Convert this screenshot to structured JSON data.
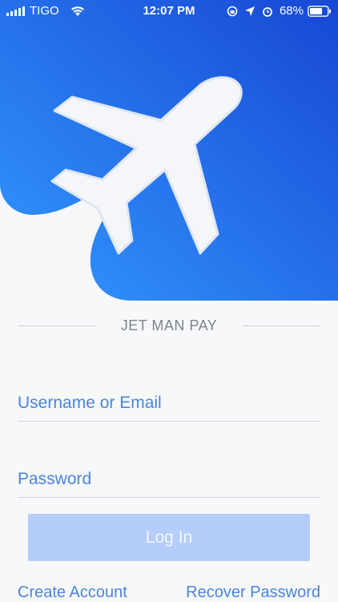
{
  "status_bar": {
    "carrier": "TIGO",
    "time": "12:07 PM",
    "battery_percent": "68%",
    "icons": [
      "signal-icon",
      "wifi-icon",
      "screen-lock-icon",
      "location-icon",
      "alarm-icon",
      "battery-icon"
    ]
  },
  "hero": {
    "icon": "airplane-icon",
    "gradient_colors": [
      "#2f8ffb",
      "#1a4fd8"
    ],
    "plane_color": "#f4f6f9"
  },
  "brand": {
    "title": "JET MAN PAY"
  },
  "form": {
    "username_placeholder": "Username or Email",
    "password_placeholder": "Password",
    "login_label": "Log In"
  },
  "links": {
    "create_account": "Create Account",
    "recover_password": "Recover Password"
  },
  "colors": {
    "accent": "#4a84dc",
    "button_disabled": "#b4cdfa",
    "background": "#f7f8fa"
  }
}
